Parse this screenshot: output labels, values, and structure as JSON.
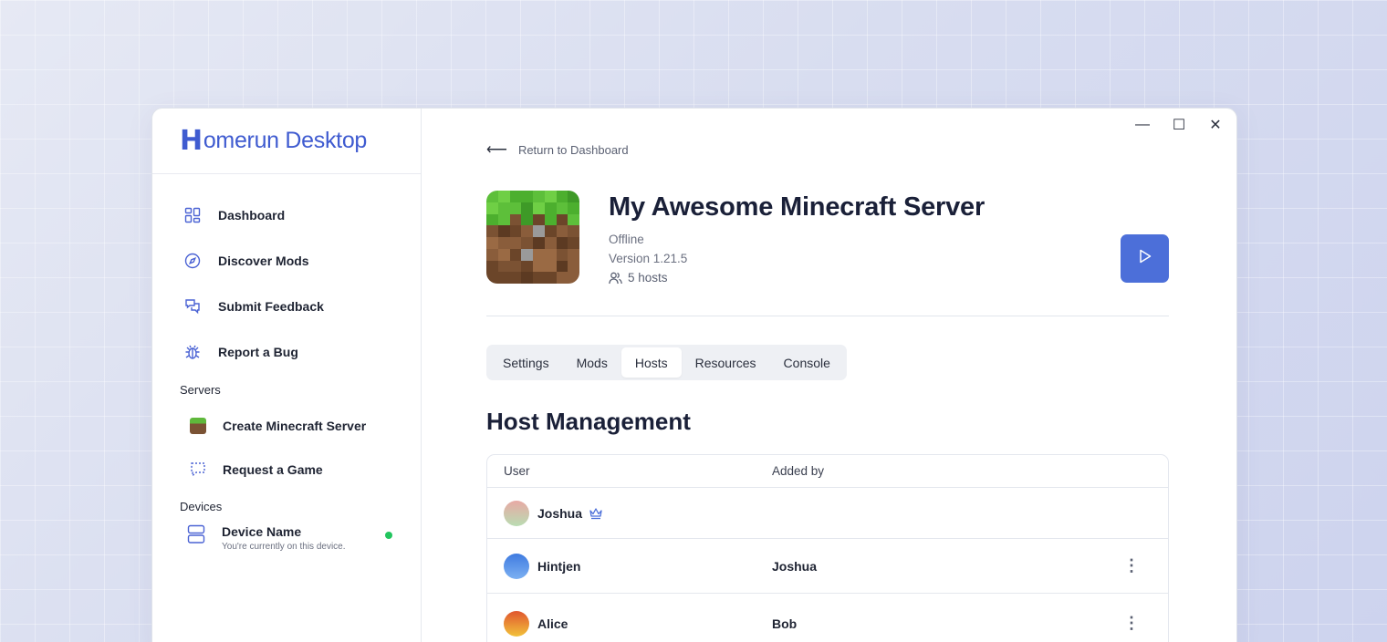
{
  "app": {
    "logo_text": "omerun Desktop",
    "logo_letter": "H"
  },
  "sidebar": {
    "items": [
      {
        "label": "Dashboard",
        "icon": "grid-icon"
      },
      {
        "label": "Discover Mods",
        "icon": "compass-icon"
      },
      {
        "label": "Submit Feedback",
        "icon": "chat-icon"
      },
      {
        "label": "Report a Bug",
        "icon": "bug-icon"
      }
    ],
    "servers_label": "Servers",
    "servers": [
      {
        "label": "Create Minecraft Server",
        "icon": "grass-block-icon"
      },
      {
        "label": "Request a Game",
        "icon": "dashed-chat-icon"
      }
    ],
    "devices_label": "Devices",
    "device": {
      "name": "Device Name",
      "subtitle": "You're currently on this device.",
      "status_color": "#22c55e"
    }
  },
  "window_controls": {
    "minimize": "—",
    "maximize": "☐",
    "close": "✕"
  },
  "main": {
    "back_label": "Return to Dashboard",
    "server": {
      "title": "My Awesome Minecraft Server",
      "status": "Offline",
      "version": "Version 1.21.5",
      "hosts": "5 hosts"
    },
    "tabs": [
      {
        "label": "Settings",
        "active": false
      },
      {
        "label": "Mods",
        "active": false
      },
      {
        "label": "Hosts",
        "active": true
      },
      {
        "label": "Resources",
        "active": false
      },
      {
        "label": "Console",
        "active": false
      }
    ],
    "section_title": "Host Management",
    "table": {
      "headers": {
        "user": "User",
        "added_by": "Added by"
      },
      "rows": [
        {
          "user": "Joshua",
          "added_by": "",
          "owner": true,
          "avatar_gradient": [
            "#e8a9a4",
            "#b9dcb2"
          ]
        },
        {
          "user": "Hintjen",
          "added_by": "Joshua",
          "owner": false,
          "avatar_gradient": [
            "#3f7be0",
            "#7cb0f2"
          ]
        },
        {
          "user": "Alice",
          "added_by": "Bob",
          "owner": false,
          "avatar_gradient": [
            "#e0562f",
            "#f2c23a"
          ]
        }
      ]
    }
  },
  "colors": {
    "accent": "#4c6fd9",
    "brand": "#3f5bd0"
  }
}
